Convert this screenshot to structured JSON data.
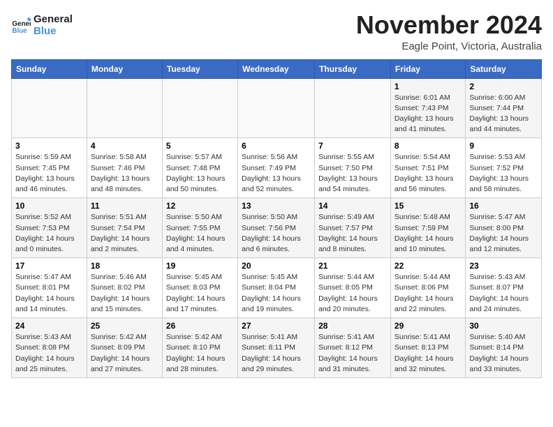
{
  "header": {
    "logo_text_general": "General",
    "logo_text_blue": "Blue",
    "month_title": "November 2024",
    "location": "Eagle Point, Victoria, Australia"
  },
  "weekdays": [
    "Sunday",
    "Monday",
    "Tuesday",
    "Wednesday",
    "Thursday",
    "Friday",
    "Saturday"
  ],
  "weeks": [
    [
      {
        "day": "",
        "detail": ""
      },
      {
        "day": "",
        "detail": ""
      },
      {
        "day": "",
        "detail": ""
      },
      {
        "day": "",
        "detail": ""
      },
      {
        "day": "",
        "detail": ""
      },
      {
        "day": "1",
        "detail": "Sunrise: 6:01 AM\nSunset: 7:43 PM\nDaylight: 13 hours\nand 41 minutes."
      },
      {
        "day": "2",
        "detail": "Sunrise: 6:00 AM\nSunset: 7:44 PM\nDaylight: 13 hours\nand 44 minutes."
      }
    ],
    [
      {
        "day": "3",
        "detail": "Sunrise: 5:59 AM\nSunset: 7:45 PM\nDaylight: 13 hours\nand 46 minutes."
      },
      {
        "day": "4",
        "detail": "Sunrise: 5:58 AM\nSunset: 7:46 PM\nDaylight: 13 hours\nand 48 minutes."
      },
      {
        "day": "5",
        "detail": "Sunrise: 5:57 AM\nSunset: 7:48 PM\nDaylight: 13 hours\nand 50 minutes."
      },
      {
        "day": "6",
        "detail": "Sunrise: 5:56 AM\nSunset: 7:49 PM\nDaylight: 13 hours\nand 52 minutes."
      },
      {
        "day": "7",
        "detail": "Sunrise: 5:55 AM\nSunset: 7:50 PM\nDaylight: 13 hours\nand 54 minutes."
      },
      {
        "day": "8",
        "detail": "Sunrise: 5:54 AM\nSunset: 7:51 PM\nDaylight: 13 hours\nand 56 minutes."
      },
      {
        "day": "9",
        "detail": "Sunrise: 5:53 AM\nSunset: 7:52 PM\nDaylight: 13 hours\nand 58 minutes."
      }
    ],
    [
      {
        "day": "10",
        "detail": "Sunrise: 5:52 AM\nSunset: 7:53 PM\nDaylight: 14 hours\nand 0 minutes."
      },
      {
        "day": "11",
        "detail": "Sunrise: 5:51 AM\nSunset: 7:54 PM\nDaylight: 14 hours\nand 2 minutes."
      },
      {
        "day": "12",
        "detail": "Sunrise: 5:50 AM\nSunset: 7:55 PM\nDaylight: 14 hours\nand 4 minutes."
      },
      {
        "day": "13",
        "detail": "Sunrise: 5:50 AM\nSunset: 7:56 PM\nDaylight: 14 hours\nand 6 minutes."
      },
      {
        "day": "14",
        "detail": "Sunrise: 5:49 AM\nSunset: 7:57 PM\nDaylight: 14 hours\nand 8 minutes."
      },
      {
        "day": "15",
        "detail": "Sunrise: 5:48 AM\nSunset: 7:59 PM\nDaylight: 14 hours\nand 10 minutes."
      },
      {
        "day": "16",
        "detail": "Sunrise: 5:47 AM\nSunset: 8:00 PM\nDaylight: 14 hours\nand 12 minutes."
      }
    ],
    [
      {
        "day": "17",
        "detail": "Sunrise: 5:47 AM\nSunset: 8:01 PM\nDaylight: 14 hours\nand 14 minutes."
      },
      {
        "day": "18",
        "detail": "Sunrise: 5:46 AM\nSunset: 8:02 PM\nDaylight: 14 hours\nand 15 minutes."
      },
      {
        "day": "19",
        "detail": "Sunrise: 5:45 AM\nSunset: 8:03 PM\nDaylight: 14 hours\nand 17 minutes."
      },
      {
        "day": "20",
        "detail": "Sunrise: 5:45 AM\nSunset: 8:04 PM\nDaylight: 14 hours\nand 19 minutes."
      },
      {
        "day": "21",
        "detail": "Sunrise: 5:44 AM\nSunset: 8:05 PM\nDaylight: 14 hours\nand 20 minutes."
      },
      {
        "day": "22",
        "detail": "Sunrise: 5:44 AM\nSunset: 8:06 PM\nDaylight: 14 hours\nand 22 minutes."
      },
      {
        "day": "23",
        "detail": "Sunrise: 5:43 AM\nSunset: 8:07 PM\nDaylight: 14 hours\nand 24 minutes."
      }
    ],
    [
      {
        "day": "24",
        "detail": "Sunrise: 5:43 AM\nSunset: 8:08 PM\nDaylight: 14 hours\nand 25 minutes."
      },
      {
        "day": "25",
        "detail": "Sunrise: 5:42 AM\nSunset: 8:09 PM\nDaylight: 14 hours\nand 27 minutes."
      },
      {
        "day": "26",
        "detail": "Sunrise: 5:42 AM\nSunset: 8:10 PM\nDaylight: 14 hours\nand 28 minutes."
      },
      {
        "day": "27",
        "detail": "Sunrise: 5:41 AM\nSunset: 8:11 PM\nDaylight: 14 hours\nand 29 minutes."
      },
      {
        "day": "28",
        "detail": "Sunrise: 5:41 AM\nSunset: 8:12 PM\nDaylight: 14 hours\nand 31 minutes."
      },
      {
        "day": "29",
        "detail": "Sunrise: 5:41 AM\nSunset: 8:13 PM\nDaylight: 14 hours\nand 32 minutes."
      },
      {
        "day": "30",
        "detail": "Sunrise: 5:40 AM\nSunset: 8:14 PM\nDaylight: 14 hours\nand 33 minutes."
      }
    ]
  ]
}
